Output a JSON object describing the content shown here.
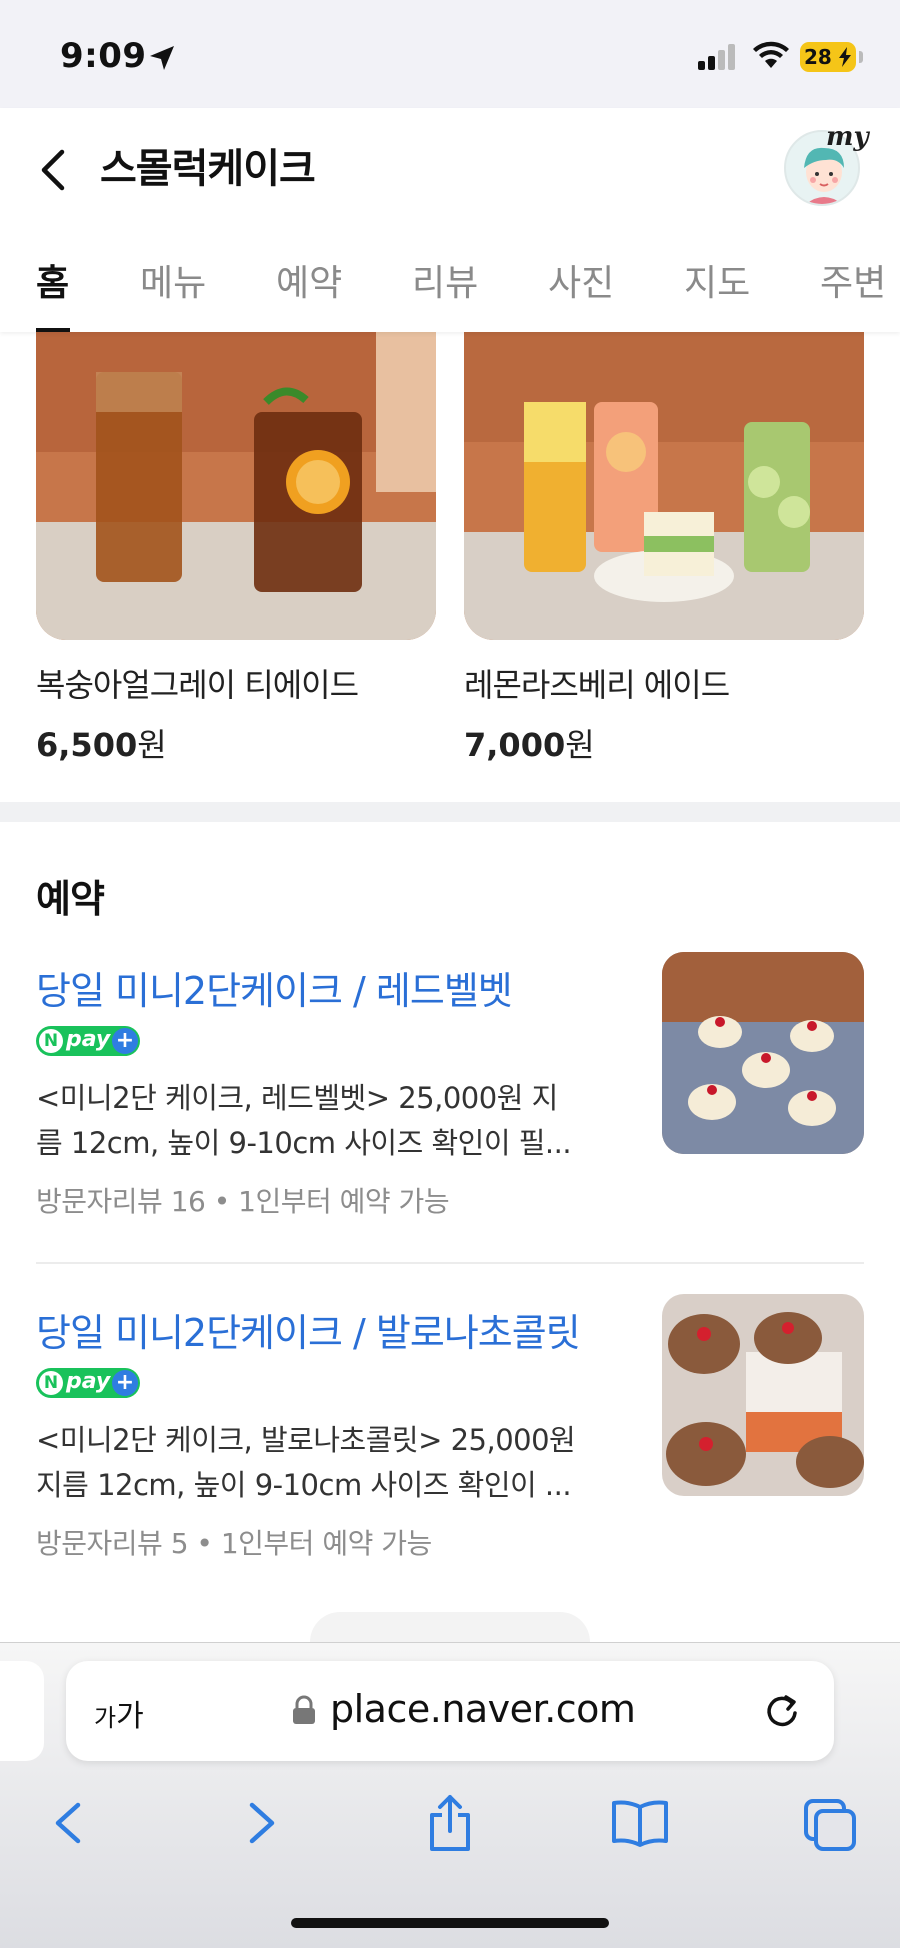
{
  "status_bar": {
    "time": "9:09",
    "battery": "28"
  },
  "header": {
    "back_icon": "chevron-left-icon",
    "title": "스몰럭케이크",
    "my_label": "my"
  },
  "tabs": [
    {
      "label": "홈",
      "active": true
    },
    {
      "label": "메뉴"
    },
    {
      "label": "예약"
    },
    {
      "label": "리뷰"
    },
    {
      "label": "사진"
    },
    {
      "label": "지도"
    },
    {
      "label": "주변"
    }
  ],
  "menu_items": [
    {
      "name": "복숭아얼그레이 티에이드",
      "price": "6,500",
      "unit": "원"
    },
    {
      "name": "레몬라즈베리 에이드",
      "price": "7,000",
      "unit": "원"
    }
  ],
  "reservation": {
    "section_title": "예약",
    "items": [
      {
        "title": "당일 미니2단케이크 / 레드벨벳",
        "badge": "pay",
        "badge_n": "N",
        "desc_line1": "<미니2단 케이크, 레드벨벳> 25,000원 지",
        "desc_line2": "름 12cm, 높이 9-10cm 사이즈 확인이 필...",
        "meta": "방문자리뷰 16 • 1인부터 예약 가능"
      },
      {
        "title": "당일 미니2단케이크 / 발로나초콜릿",
        "badge": "pay",
        "badge_n": "N",
        "desc_line1": "<미니2단 케이크, 발로나초콜릿> 25,000원",
        "desc_line2": "지름 12cm, 높이 9-10cm 사이즈 확인이 ...",
        "meta": "방문자리뷰 5 • 1인부터 예약 가능"
      }
    ]
  },
  "browser": {
    "font_btn_small": "가",
    "font_btn_large": "가",
    "url": "place.naver.com"
  },
  "colors": {
    "link_blue": "#2a6fd6",
    "npay_green": "#19c25b",
    "safari_blue": "#2f7de1"
  }
}
